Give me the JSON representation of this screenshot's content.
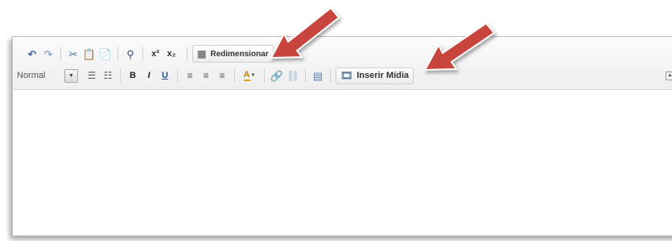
{
  "toolbar": {
    "row1": {
      "undo_icon": "undo-icon",
      "redo_icon": "redo-icon",
      "cut_icon": "scissors-icon",
      "paste_icon": "paste-icon",
      "paste_word_icon": "paste-word-icon",
      "find_icon": "binoculars-icon",
      "superscript_label": "x²",
      "subscript_label": "x₂",
      "resize_label": "Redimensionar"
    },
    "row2": {
      "format_value": "Normal",
      "bold_label": "B",
      "italic_label": "I",
      "underline_label": "U",
      "text_color_label": "A",
      "insert_media_label": "Inserir Mídia"
    }
  },
  "colors": {
    "arrow": "#c8453d",
    "accent_icon": "#5a8fc7"
  }
}
